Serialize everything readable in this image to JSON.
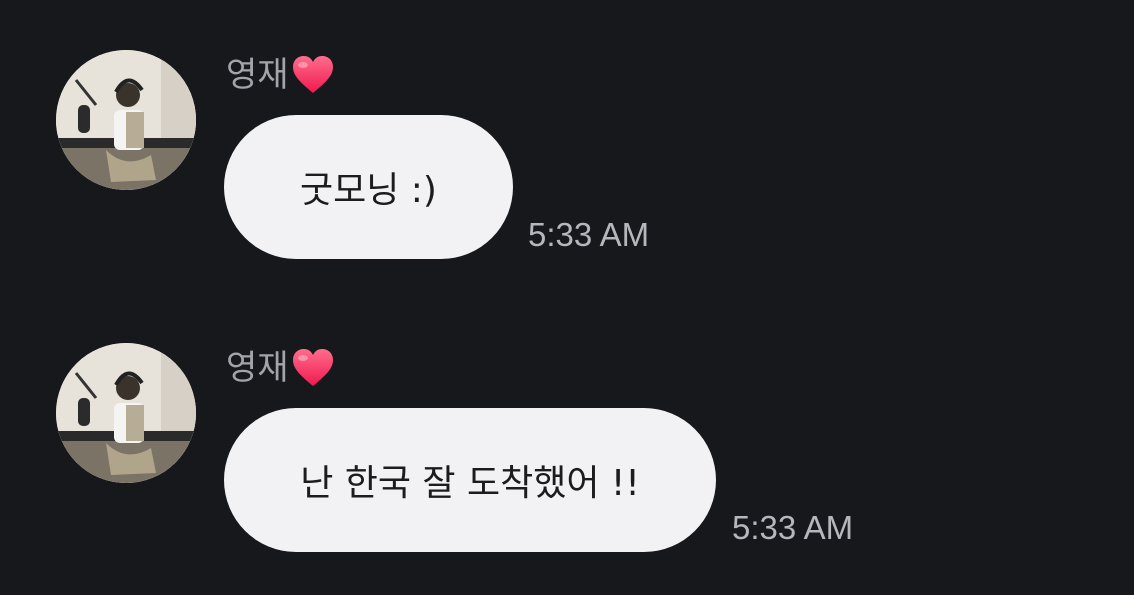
{
  "messages": [
    {
      "sender": "영재",
      "sender_icon": "heart-icon",
      "avatar": "profile-photo-avatar",
      "text": "굿모닝 :)",
      "time": "5:33 AM"
    },
    {
      "sender": "영재",
      "sender_icon": "heart-icon",
      "avatar": "profile-photo-avatar",
      "text": "난 한국 잘 도착했어 !!",
      "time": "5:33 AM"
    }
  ],
  "colors": {
    "background": "#17181c",
    "bubble": "#f2f2f4",
    "bubble_text": "#1c1c1e",
    "sender_name": "#a3a3aa",
    "timestamp": "#b6b6bc",
    "heart": "#ff3b6a"
  }
}
